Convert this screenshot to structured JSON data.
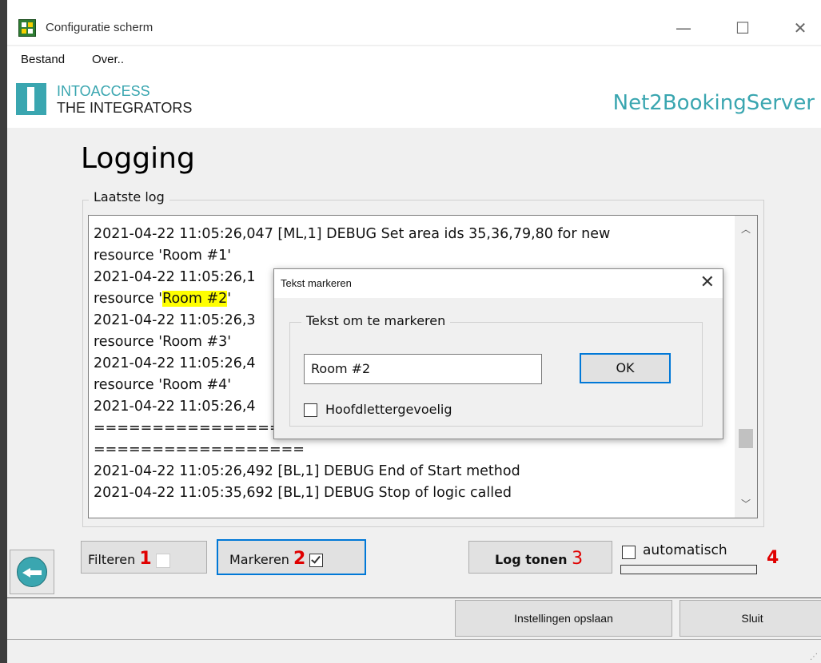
{
  "window": {
    "title": "Configuratie scherm",
    "minimize": "—",
    "maximize": "☐",
    "close": "✕"
  },
  "menu": {
    "items": [
      "Bestand",
      "Over.."
    ]
  },
  "brand": {
    "line1": "INTOACCESS",
    "line2": "THE INTEGRATORS",
    "server": "Net2BookingServer",
    "accent_color": "#3aa6b0"
  },
  "page": {
    "title": "Logging"
  },
  "log": {
    "group_label": "Laatste log",
    "lines": [
      "2021-04-22 11:05:26,047 [ML,1] DEBUG Set area ids 35,36,79,80 for new",
      "resource 'Room #1'",
      "2021-04-22 11:05:26,1",
      "resource '",
      "Room #2",
      "'",
      "2021-04-22 11:05:26,3",
      "resource 'Room #3'",
      "2021-04-22 11:05:26,4",
      "resource 'Room #4'",
      "2021-04-22 11:05:26,4",
      "==================",
      "==================",
      "2021-04-22 11:05:26,492 [BL,1] DEBUG End of Start method",
      "2021-04-22 11:05:35,692 [BL,1] DEBUG Stop of logic called"
    ],
    "highlight_color": "#ffff00"
  },
  "dialog": {
    "title": "Tekst markeren",
    "close": "✕",
    "group_label": "Tekst om te markeren",
    "input_value": "Room #2",
    "ok_label": "OK",
    "case_sensitive_label": "Hoofdlettergevoelig"
  },
  "controls": {
    "filter_label": "Filteren",
    "filter_num": "1",
    "mark_label": "Markeren",
    "mark_num": "2",
    "show_log_label": "Log tonen",
    "show_log_num": "3",
    "auto_label": "automatisch",
    "auto_num": "4",
    "annotation_color": "#e00000"
  },
  "footer": {
    "save_label": "Instellingen opslaan",
    "close_label": "Sluit"
  }
}
